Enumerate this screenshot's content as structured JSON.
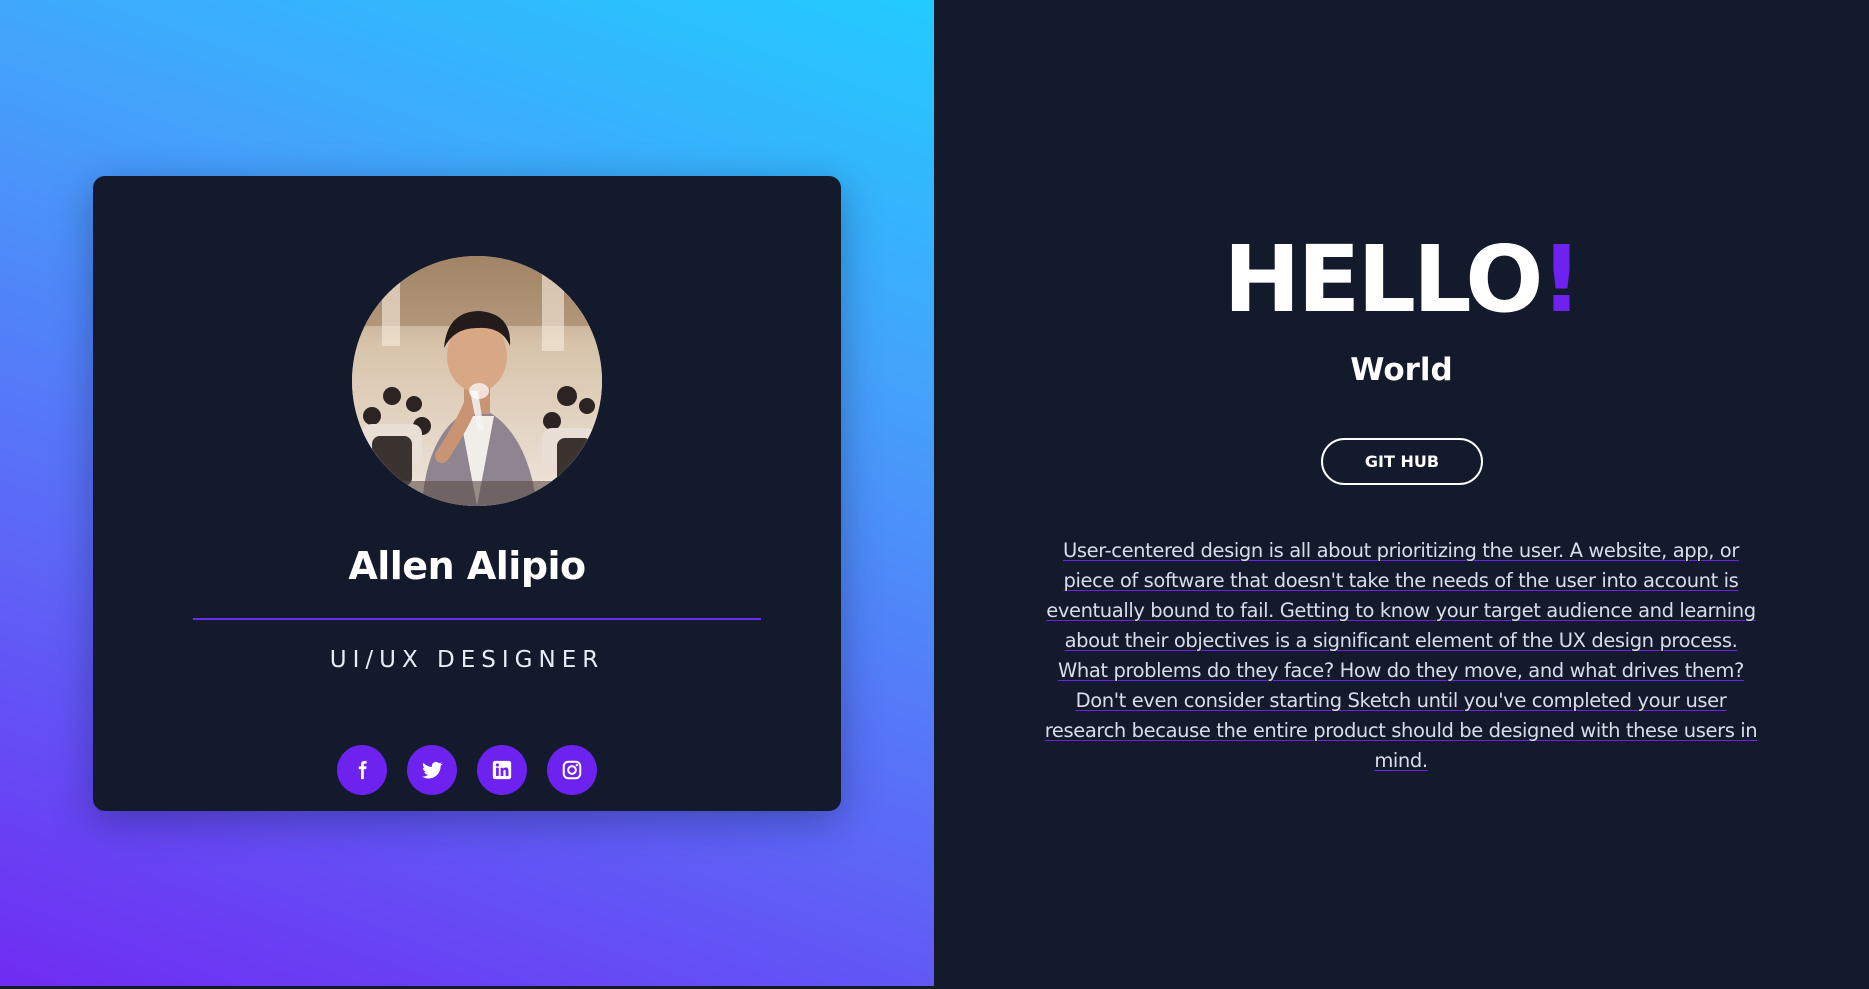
{
  "card": {
    "name": "Allen Alipio",
    "role": "UI/UX DESIGNER",
    "socials": [
      {
        "icon": "facebook-icon"
      },
      {
        "icon": "twitter-icon"
      },
      {
        "icon": "linkedin-icon"
      },
      {
        "icon": "instagram-icon"
      }
    ]
  },
  "hero": {
    "hello": "HELLO",
    "exclamation": "!",
    "subtitle": "World",
    "button_label": "GIT HUB",
    "description": "User-centered design is all about prioritizing the user. A website, app, or piece of software that doesn't take the needs of the user into account is eventually bound to fail. Getting to know your target audience and learning about their objectives is a significant element of the UX design process. What problems do they face? How do they move, and what drives them? Don't even consider starting Sketch until you've completed your user research because the entire product should be designed with these users in mind."
  },
  "colors": {
    "accent": "#6d22ef",
    "panel_bg": "#131a2c",
    "gradient_top": "#22cbff",
    "gradient_bottom": "#6f2cf2"
  }
}
